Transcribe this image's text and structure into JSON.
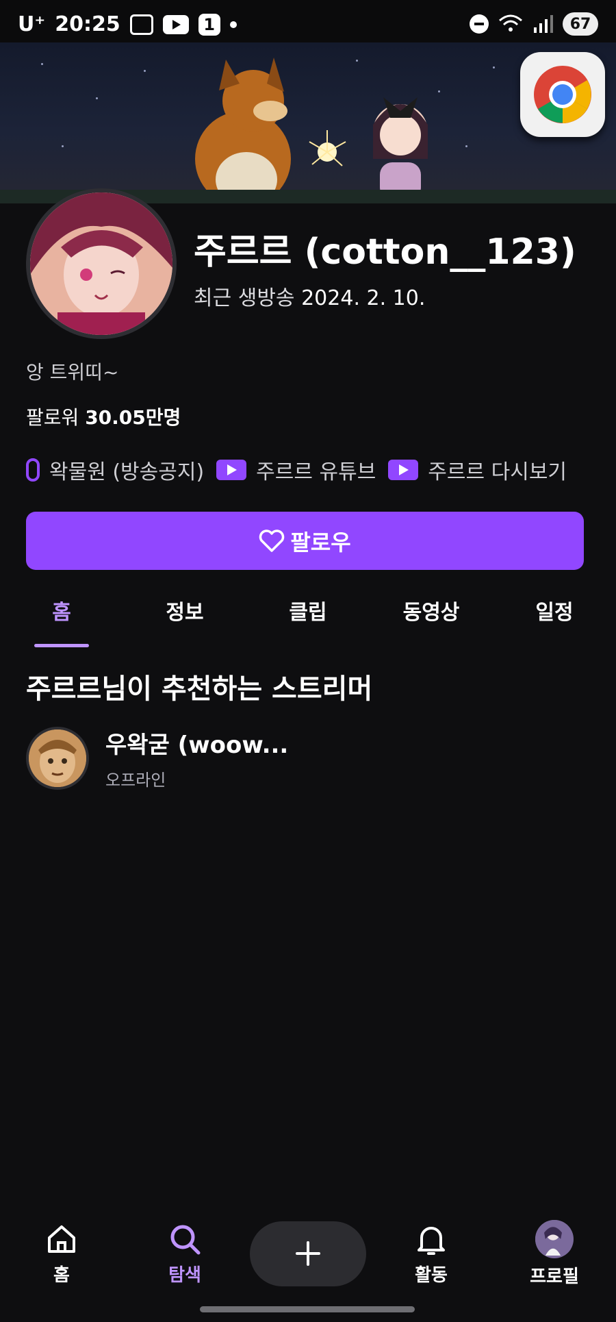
{
  "status_bar": {
    "carrier": "U⁺",
    "time": "20:25",
    "notification_count": "1",
    "battery": "67"
  },
  "profile": {
    "name": "주르르 (cotton__123)",
    "last_live_label": "최근 생방송",
    "last_live_date": "2024. 2. 10.",
    "bio": "앙 트위띠~",
    "followers_label": "팔로워",
    "followers_count": "30.05만명"
  },
  "links": [
    {
      "label": "왁물원 (방송공지)",
      "icon": "link-icon"
    },
    {
      "label": "주르르 유튜브",
      "icon": "youtube-icon"
    },
    {
      "label": "주르르 다시보기",
      "icon": "youtube-icon"
    }
  ],
  "follow_button": {
    "label": "팔로우"
  },
  "tabs": [
    "홈",
    "정보",
    "클립",
    "동영상",
    "일정"
  ],
  "active_tab": "홈",
  "recommended": {
    "title": "주르르님이 추천하는 스트리머",
    "streamers": [
      {
        "name": "우왁굳 (woow...",
        "status": "오프라인"
      }
    ]
  },
  "bottom_nav": {
    "home": "홈",
    "explore": "탐색",
    "activity": "활동",
    "profile": "프로필"
  },
  "colors": {
    "accent": "#9147ff",
    "accent_light": "#bf94ff",
    "background": "#0e0e10"
  }
}
